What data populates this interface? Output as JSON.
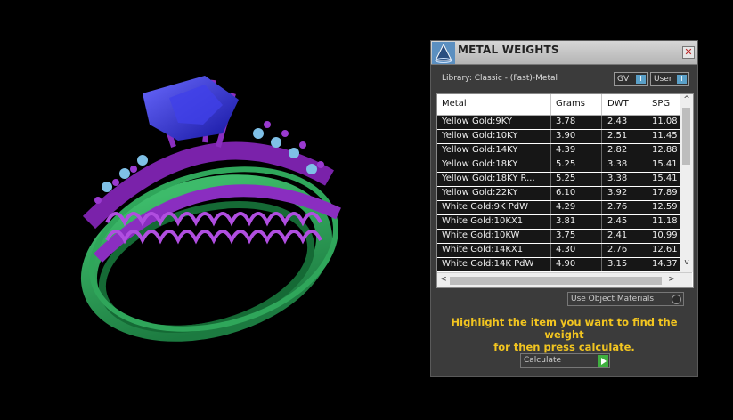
{
  "window": {
    "title": "METAL WEIGHTS",
    "close_glyph": "✕"
  },
  "library": {
    "label": "Library: Classic - (Fast)-Metal"
  },
  "toggles": {
    "gv_label": "GV",
    "user_label": "User",
    "toggle_glyph": "I"
  },
  "table": {
    "headers": [
      "Metal",
      "Grams",
      "DWT",
      "SPG"
    ],
    "rows": [
      [
        "Yellow Gold:9KY",
        "3.78",
        "2.43",
        "11.08"
      ],
      [
        "Yellow Gold:10KY",
        "3.90",
        "2.51",
        "11.45"
      ],
      [
        "Yellow Gold:14KY",
        "4.39",
        "2.82",
        "12.88"
      ],
      [
        "Yellow Gold:18KY",
        "5.25",
        "3.38",
        "15.41"
      ],
      [
        "Yellow Gold:18KY R...",
        "5.25",
        "3.38",
        "15.41"
      ],
      [
        "Yellow Gold:22KY",
        "6.10",
        "3.92",
        "17.89"
      ],
      [
        "White Gold:9K PdW",
        "4.29",
        "2.76",
        "12.59"
      ],
      [
        "White Gold:10KX1",
        "3.81",
        "2.45",
        "11.18"
      ],
      [
        "White Gold:10KW",
        "3.75",
        "2.41",
        "10.99"
      ],
      [
        "White Gold:14KX1",
        "4.30",
        "2.76",
        "12.61"
      ],
      [
        "White Gold:14K PdW",
        "4.90",
        "3.15",
        "14.37"
      ]
    ],
    "scroll_up": "^",
    "scroll_down": "v",
    "scroll_left": "<",
    "scroll_right": ">"
  },
  "use_object_materials": {
    "label": "Use Object Materials"
  },
  "hint": {
    "line1": "Highlight the item you want to find the weight",
    "line2": "for then press calculate."
  },
  "calculate": {
    "label": "Calculate"
  },
  "colors": {
    "hint": "#f2c520",
    "accent": "#5aa0c8",
    "ring_metal": "#8a2ec0",
    "ring_band": "#2fa65a",
    "gem": "#2a2ad8"
  }
}
